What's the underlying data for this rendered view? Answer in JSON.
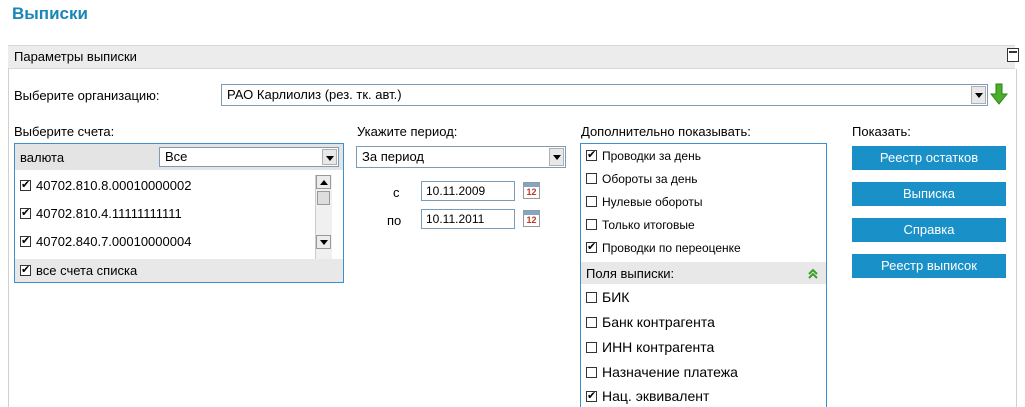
{
  "page_title": "Выписки",
  "panel": {
    "title": "Параметры выписки"
  },
  "organization": {
    "label": "Выберите организацию:",
    "value": "РАО Карлиолиз (рез. тк. авт.)"
  },
  "accounts": {
    "label": "Выберите счета:",
    "currency_label": "валюта",
    "currency_value": "Все",
    "items": [
      {
        "number": "40702.810.8.00010000002",
        "checked": true
      },
      {
        "number": "40702.810.4.11111111111",
        "checked": true
      },
      {
        "number": "40702.840.7.00010000004",
        "checked": true
      }
    ],
    "all_label": "все счета списка"
  },
  "period": {
    "label": "Укажите период:",
    "type_value": "За период",
    "from_label": "с",
    "from_value": "10.11.2009",
    "to_label": "по",
    "to_value": "10.11.2011",
    "calendar_day": "12"
  },
  "extra": {
    "label": "Дополнительно показывать:",
    "options": [
      {
        "label": "Проводки за день",
        "checked": true
      },
      {
        "label": "Обороты за день",
        "checked": false
      },
      {
        "label": "Нулевые обороты",
        "checked": false
      },
      {
        "label": "Только итоговые",
        "checked": false
      },
      {
        "label": "Проводки по переоценке",
        "checked": true
      }
    ],
    "fields_label": "Поля выписки:",
    "fields": [
      {
        "label": "БИК",
        "checked": false
      },
      {
        "label": "Банк контрагента",
        "checked": false
      },
      {
        "label": "ИНН контрагента",
        "checked": false
      },
      {
        "label": "Назначение платежа",
        "checked": false
      },
      {
        "label": "Нац. эквивалент",
        "checked": true
      }
    ]
  },
  "show": {
    "label": "Показать:",
    "buttons": [
      "Реестр остатков",
      "Выписка",
      "Справка",
      "Реестр выписок"
    ]
  },
  "colors": {
    "accent": "#1a90c8",
    "title": "#1a86b8",
    "green_arrow": "#4caf2a"
  }
}
